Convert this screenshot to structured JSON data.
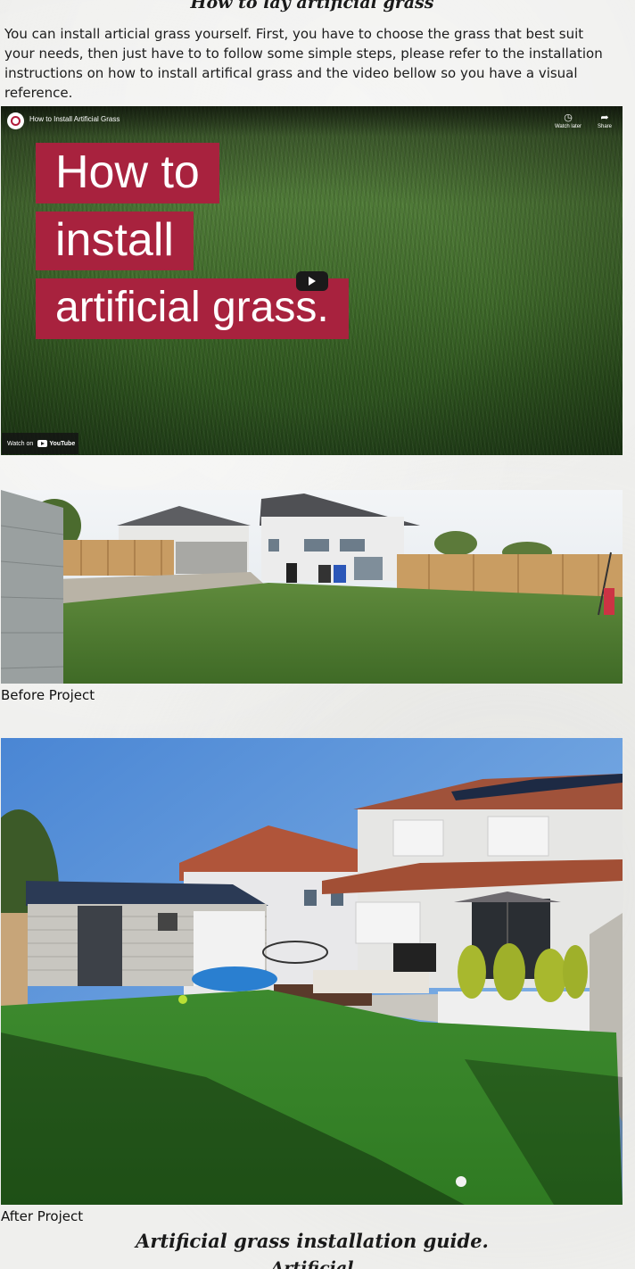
{
  "page": {
    "heading": "How to lay artificial grass",
    "intro": "You can install articial grass yourself. First, you have to choose the grass that best suit your needs, then just have to to follow some simple steps, please refer to the installation instructions on how to install artifical grass and the video bellow so you have a visual reference."
  },
  "video": {
    "channel_title": "How to Install Artificial Grass",
    "watch_later_label": "Watch later",
    "share_label": "Share",
    "thumbnail_lines": [
      "How to",
      "install",
      "artificial grass."
    ],
    "watch_on_label": "Watch on",
    "youtube_label": "YouTube",
    "thumbnail_colors": {
      "title_box": "#a8223e",
      "grass": "#4f7a37"
    }
  },
  "before": {
    "caption": "Before Project"
  },
  "after": {
    "caption": "After Project"
  },
  "footer": {
    "heading": "Artificial grass installation guide.",
    "subheading": "Artificial"
  }
}
